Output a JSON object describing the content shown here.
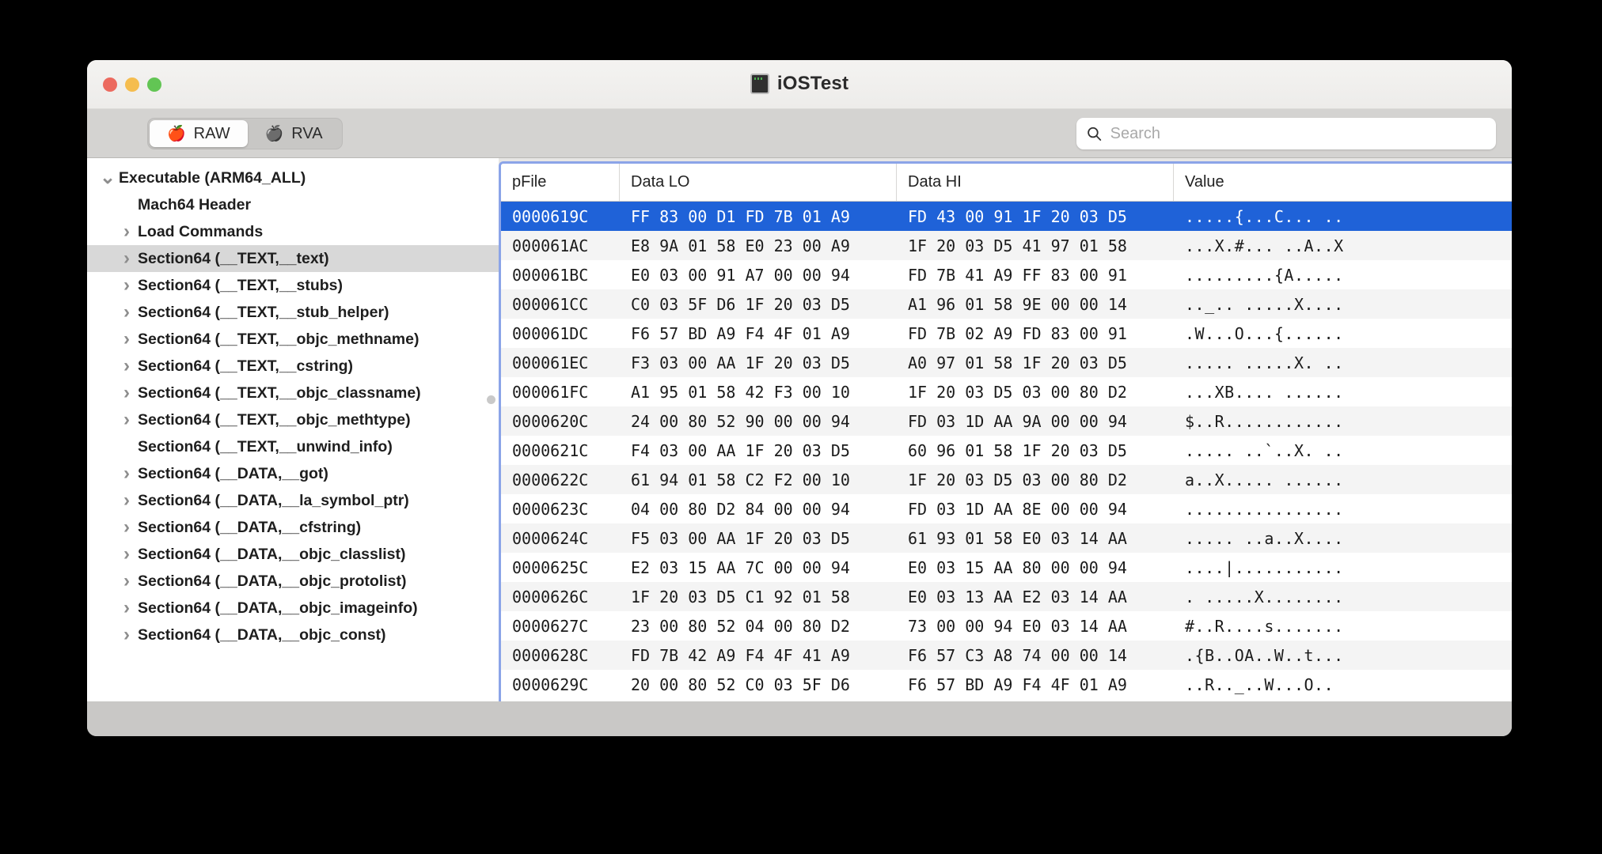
{
  "window": {
    "title": "iOSTest",
    "app_icon": "terminal-icon",
    "traffic_lights": [
      "close-button",
      "minimize-button",
      "zoom-button"
    ],
    "colors": {
      "selection_blue": "#1f62d8",
      "focus_ring": "#8ba4e8",
      "titlebar": "#f1f0ee",
      "toolbar": "#d4d3d1",
      "close": "#ec6a5f",
      "minimize": "#f5bd4f",
      "zoom": "#62c554"
    }
  },
  "toolbar": {
    "segments": [
      {
        "label": "RAW",
        "icon": "apple-red-icon",
        "active": true
      },
      {
        "label": "RVA",
        "icon": "apple-gray-icon",
        "active": false
      }
    ],
    "search": {
      "icon": "search-icon",
      "placeholder": "Search",
      "value": ""
    }
  },
  "sidebar": {
    "items": [
      {
        "label": "Executable  (ARM64_ALL)",
        "level": 1,
        "twisty": "down",
        "selected": false
      },
      {
        "label": "Mach64 Header",
        "level": 2,
        "twisty": "none",
        "selected": false
      },
      {
        "label": "Load Commands",
        "level": 2,
        "twisty": "right",
        "selected": false
      },
      {
        "label": "Section64 (__TEXT,__text)",
        "level": 2,
        "twisty": "right",
        "selected": true
      },
      {
        "label": "Section64 (__TEXT,__stubs)",
        "level": 2,
        "twisty": "right",
        "selected": false
      },
      {
        "label": "Section64 (__TEXT,__stub_helper)",
        "level": 2,
        "twisty": "right",
        "selected": false
      },
      {
        "label": "Section64 (__TEXT,__objc_methname)",
        "level": 2,
        "twisty": "right",
        "selected": false
      },
      {
        "label": "Section64 (__TEXT,__cstring)",
        "level": 2,
        "twisty": "right",
        "selected": false
      },
      {
        "label": "Section64 (__TEXT,__objc_classname)",
        "level": 2,
        "twisty": "right",
        "selected": false
      },
      {
        "label": "Section64 (__TEXT,__objc_methtype)",
        "level": 2,
        "twisty": "right",
        "selected": false
      },
      {
        "label": "Section64 (__TEXT,__unwind_info)",
        "level": 2,
        "twisty": "none",
        "selected": false
      },
      {
        "label": "Section64 (__DATA,__got)",
        "level": 2,
        "twisty": "right",
        "selected": false
      },
      {
        "label": "Section64 (__DATA,__la_symbol_ptr)",
        "level": 2,
        "twisty": "right",
        "selected": false
      },
      {
        "label": "Section64 (__DATA,__cfstring)",
        "level": 2,
        "twisty": "right",
        "selected": false
      },
      {
        "label": "Section64 (__DATA,__objc_classlist)",
        "level": 2,
        "twisty": "right",
        "selected": false
      },
      {
        "label": "Section64 (__DATA,__objc_protolist)",
        "level": 2,
        "twisty": "right",
        "selected": false
      },
      {
        "label": "Section64 (__DATA,__objc_imageinfo)",
        "level": 2,
        "twisty": "right",
        "selected": false
      },
      {
        "label": "Section64 (__DATA,__objc_const)",
        "level": 2,
        "twisty": "right",
        "selected": false
      }
    ],
    "scrollbar": "vertical-scrollbar"
  },
  "table": {
    "columns": [
      "pFile",
      "Data LO",
      "Data HI",
      "Value"
    ],
    "rows": [
      {
        "pFile": "0000619C",
        "lo": "FF 83 00 D1 FD 7B 01 A9",
        "hi": "FD 43 00 91 1F 20 03 D5",
        "value": ".....{...C... ..",
        "selected": true
      },
      {
        "pFile": "000061AC",
        "lo": "E8 9A 01 58 E0 23 00 A9",
        "hi": "1F 20 03 D5 41 97 01 58",
        "value": "...X.#... ..A..X",
        "selected": false
      },
      {
        "pFile": "000061BC",
        "lo": "E0 03 00 91 A7 00 00 94",
        "hi": "FD 7B 41 A9 FF 83 00 91",
        "value": ".........{A.....",
        "selected": false
      },
      {
        "pFile": "000061CC",
        "lo": "C0 03 5F D6 1F 20 03 D5",
        "hi": "A1 96 01 58 9E 00 00 14",
        "value": ".._.. .....X....",
        "selected": false
      },
      {
        "pFile": "000061DC",
        "lo": "F6 57 BD A9 F4 4F 01 A9",
        "hi": "FD 7B 02 A9 FD 83 00 91",
        "value": ".W...O...{......",
        "selected": false
      },
      {
        "pFile": "000061EC",
        "lo": "F3 03 00 AA 1F 20 03 D5",
        "hi": "A0 97 01 58 1F 20 03 D5",
        "value": "..... .....X. ..",
        "selected": false
      },
      {
        "pFile": "000061FC",
        "lo": "A1 95 01 58 42 F3 00 10",
        "hi": "1F 20 03 D5 03 00 80 D2",
        "value": "...XB.... ......",
        "selected": false
      },
      {
        "pFile": "0000620C",
        "lo": "24 00 80 52 90 00 00 94",
        "hi": "FD 03 1D AA 9A 00 00 94",
        "value": "$..R............",
        "selected": false
      },
      {
        "pFile": "0000621C",
        "lo": "F4 03 00 AA 1F 20 03 D5",
        "hi": "60 96 01 58 1F 20 03 D5",
        "value": "..... ..`..X. ..",
        "selected": false
      },
      {
        "pFile": "0000622C",
        "lo": "61 94 01 58 C2 F2 00 10",
        "hi": "1F 20 03 D5 03 00 80 D2",
        "value": "a..X..... ......",
        "selected": false
      },
      {
        "pFile": "0000623C",
        "lo": "04 00 80 D2 84 00 00 94",
        "hi": "FD 03 1D AA 8E 00 00 94",
        "value": "................",
        "selected": false
      },
      {
        "pFile": "0000624C",
        "lo": "F5 03 00 AA 1F 20 03 D5",
        "hi": "61 93 01 58 E0 03 14 AA",
        "value": "..... ..a..X....",
        "selected": false
      },
      {
        "pFile": "0000625C",
        "lo": "E2 03 15 AA 7C 00 00 94",
        "hi": "E0 03 15 AA 80 00 00 94",
        "value": "....|...........",
        "selected": false
      },
      {
        "pFile": "0000626C",
        "lo": "1F 20 03 D5 C1 92 01 58",
        "hi": "E0 03 13 AA E2 03 14 AA",
        "value": ". .....X........",
        "selected": false
      },
      {
        "pFile": "0000627C",
        "lo": "23 00 80 52 04 00 80 D2",
        "hi": "73 00 00 94 E0 03 14 AA",
        "value": "#..R....s.......",
        "selected": false
      },
      {
        "pFile": "0000628C",
        "lo": "FD 7B 42 A9 F4 4F 41 A9",
        "hi": "F6 57 C3 A8 74 00 00 14",
        "value": ".{B..OA..W..t...",
        "selected": false
      },
      {
        "pFile": "0000629C",
        "lo": "20 00 80 52 C0 03 5F D6",
        "hi": "F6 57 BD A9 F4 4F 01 A9",
        "value": " ..R.._..W...O..",
        "selected": false
      }
    ]
  }
}
